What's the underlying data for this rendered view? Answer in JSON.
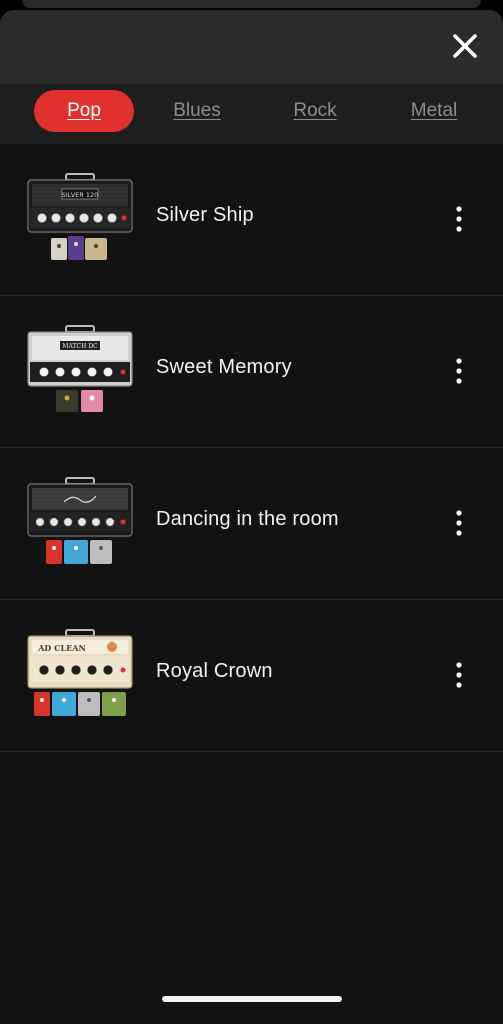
{
  "header": {
    "close_icon": "close-icon"
  },
  "tabs": [
    {
      "label": "Pop",
      "active": true
    },
    {
      "label": "Blues",
      "active": false
    },
    {
      "label": "Rock",
      "active": false
    },
    {
      "label": "Metal",
      "active": false
    }
  ],
  "presets": [
    {
      "name": "Silver Ship",
      "amp_badge": "SILVER 120",
      "amp_style": "black-grille",
      "pedals": [
        "#d8d2c4",
        "#5a3d8c",
        "#c9b98a"
      ]
    },
    {
      "name": "Sweet Memory",
      "amp_badge": "MATCH DC",
      "amp_style": "silver-grille",
      "pedals": [
        "#3a3a2a",
        "#e58aa8"
      ]
    },
    {
      "name": "Dancing in the room",
      "amp_badge": "",
      "amp_style": "dark-grille",
      "pedals": [
        "#d9342b",
        "#3fa8d8",
        "#bdbdbd"
      ]
    },
    {
      "name": "Royal Crown",
      "amp_badge": "AD CLEAN",
      "amp_style": "cream-face",
      "pedals": [
        "#d9342b",
        "#3fa8d8",
        "#bdbdbd",
        "#7ea04a"
      ]
    }
  ],
  "colors": {
    "accent": "#e0312e",
    "sheet_bg": "#121212",
    "header_bg": "#2b2b2b",
    "tabs_bg": "#1e1e1e",
    "tab_inactive": "#8d8d8d"
  }
}
